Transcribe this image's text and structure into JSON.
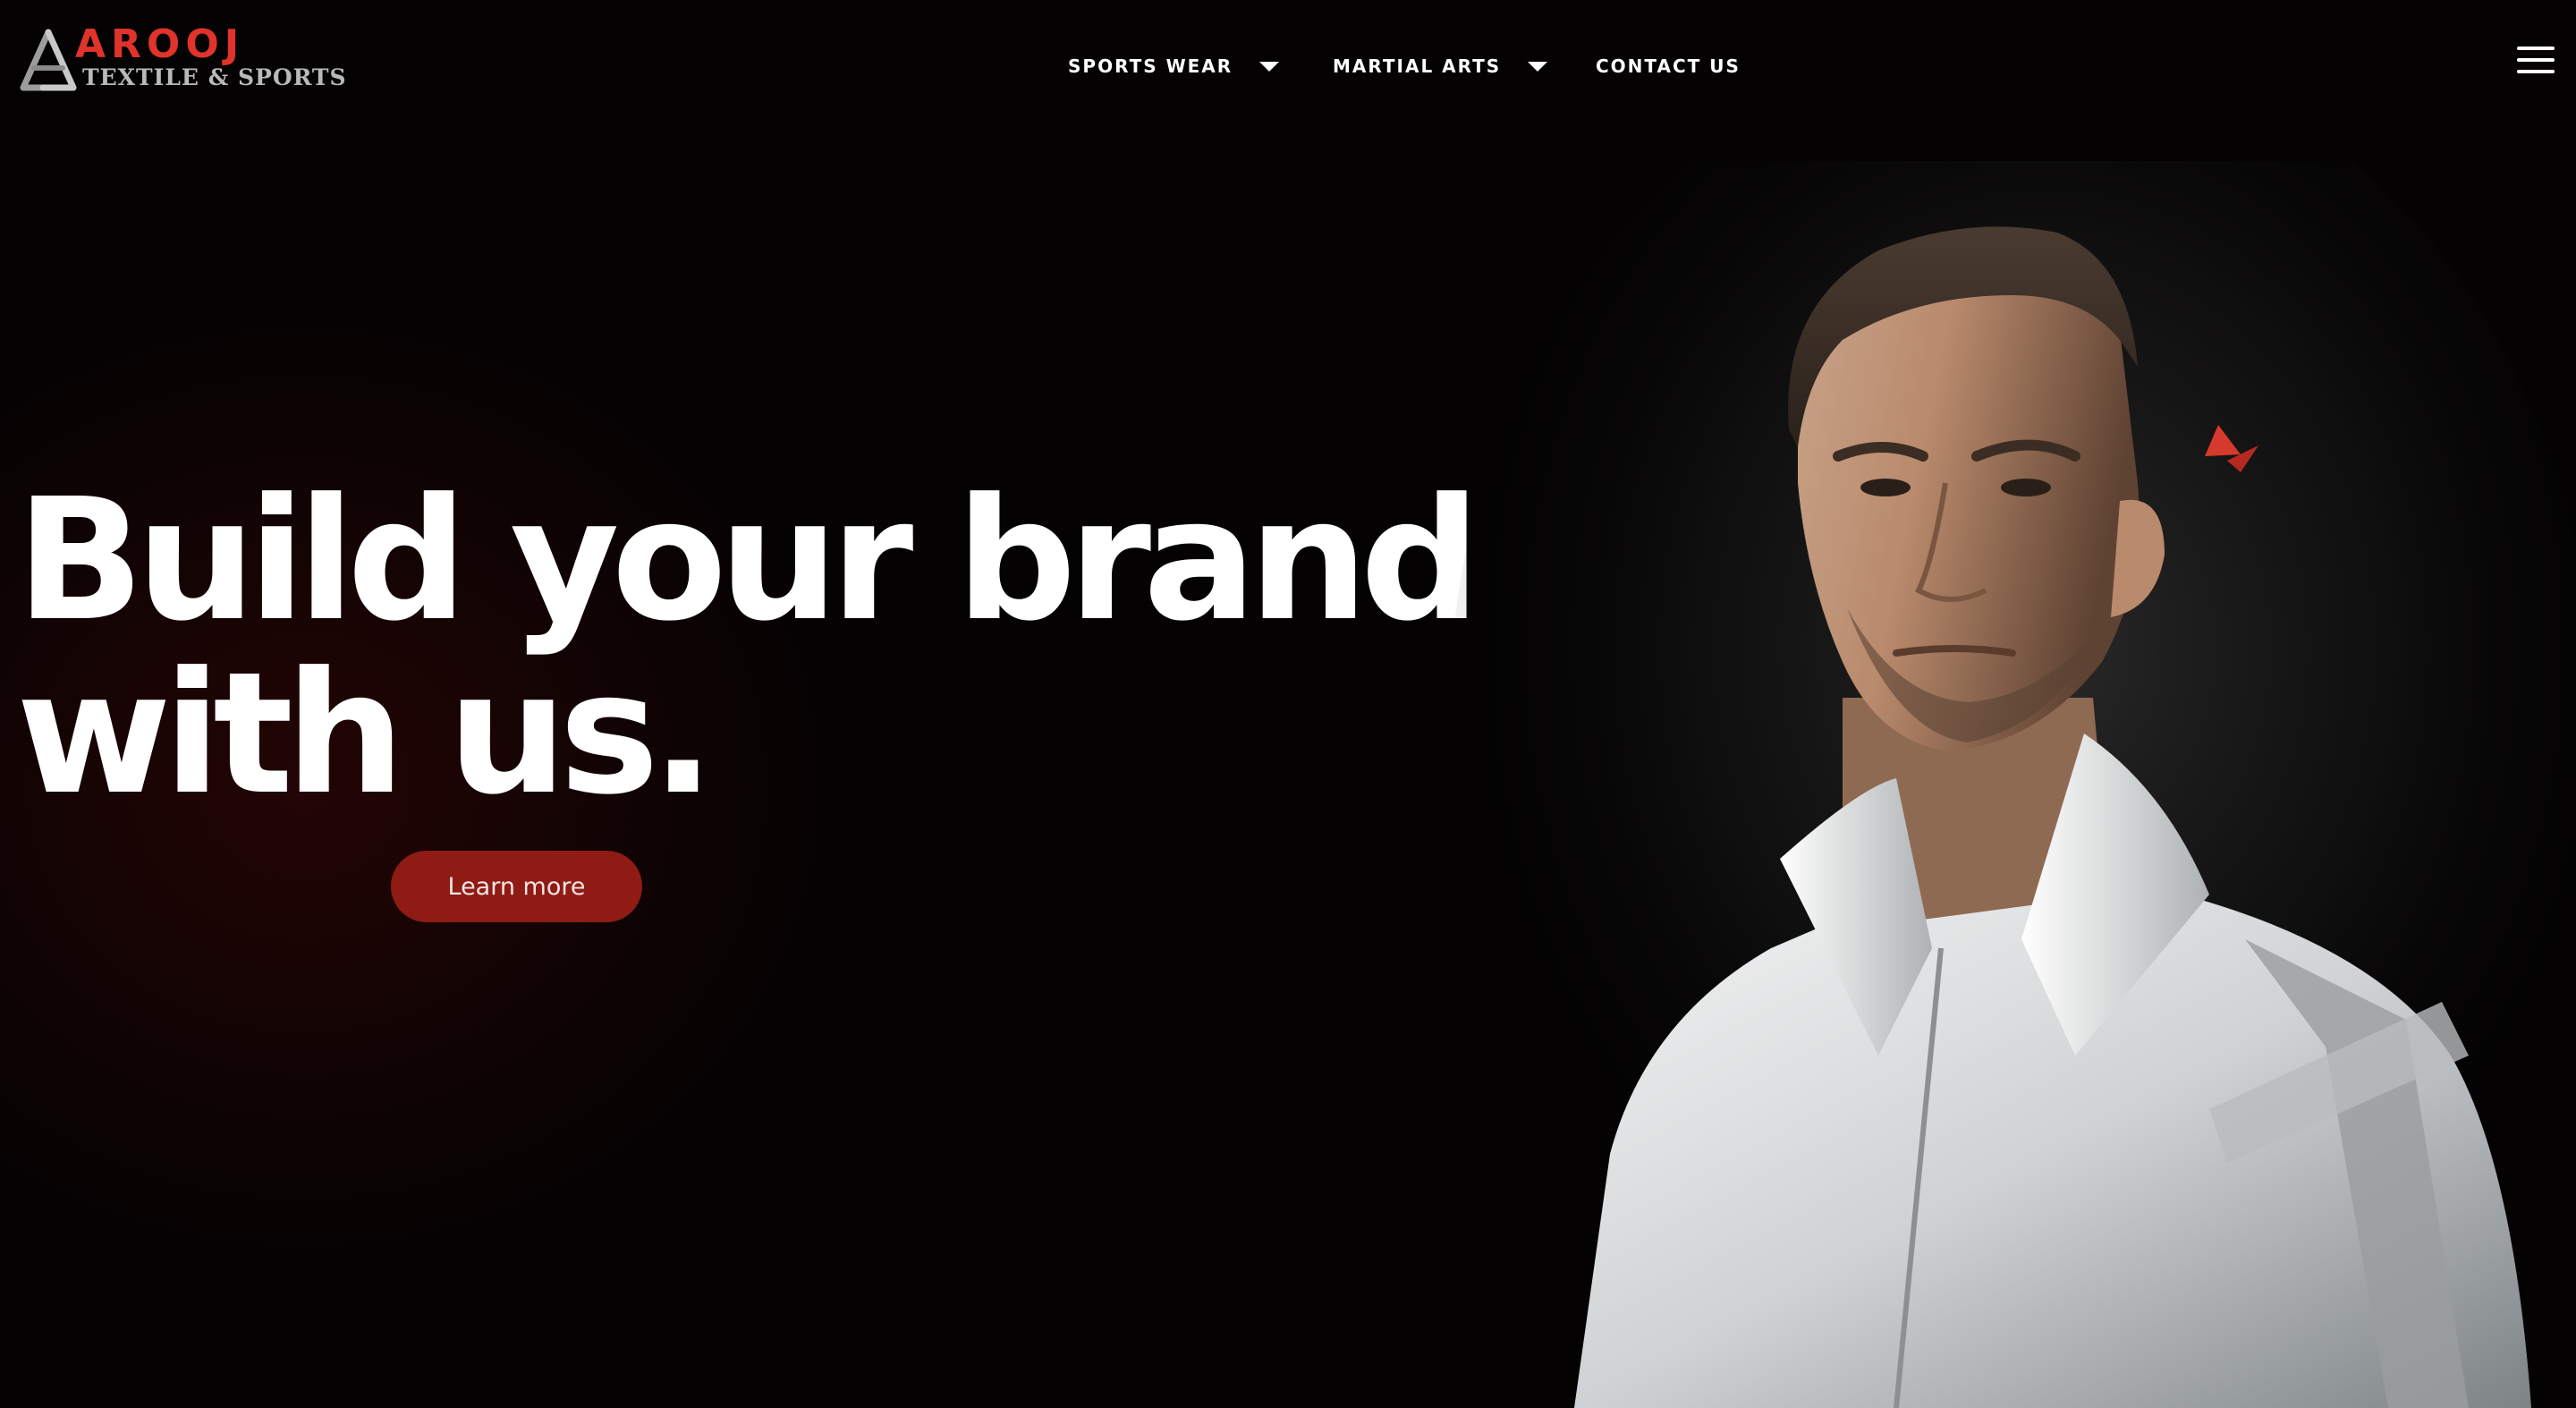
{
  "brand": {
    "name": "AROOJ",
    "tagline": "TEXTILE & SPORTS",
    "accent_color": "#e0332b",
    "logo_icon": "triangle-knot-icon"
  },
  "nav": {
    "items": [
      {
        "label": "SPORTS WEAR",
        "icon": "caret-down-icon"
      },
      {
        "label": "MARTIAL ARTS",
        "icon": "caret-down-icon"
      },
      {
        "label": "CONTACT US"
      }
    ],
    "menu_icon": "hamburger-menu-icon"
  },
  "hero": {
    "title_line_1": "Build your brand",
    "title_line_2": "with us.",
    "cta_label": "Learn more",
    "cta_color": "#8f1b14",
    "image": "man-in-white-track-jacket"
  }
}
